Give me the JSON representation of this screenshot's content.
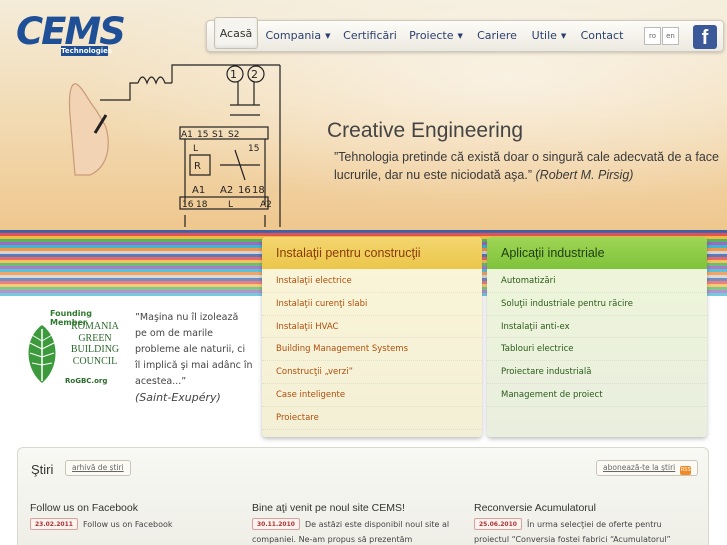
{
  "brand": {
    "name": "CEMS",
    "sub": "Technologies"
  },
  "nav": {
    "items": [
      {
        "label": "Acasă"
      },
      {
        "label": "Compania",
        "caret": "▼"
      },
      {
        "label": "Certificări"
      },
      {
        "label": "Proiecte",
        "caret": "▼"
      },
      {
        "label": "Cariere"
      },
      {
        "label": "Utile",
        "caret": "▼"
      },
      {
        "label": "Contact"
      }
    ],
    "lang": [
      "ro",
      "en"
    ],
    "fb": "f"
  },
  "hero": {
    "sketch_labels": [
      "1",
      "2",
      "A1",
      "15",
      "S1",
      "S2",
      "L",
      "15",
      "R",
      "A1",
      "A2",
      "16",
      "18",
      "16",
      "18",
      "L",
      "A2"
    ],
    "title": "Creative Engineering",
    "quote": "”Tehnologia pretinde că există doar o singură cale adecvată de a face lucrurile, dar nu este niciodată aşa.”",
    "author": "(Robert M. Pirsig)"
  },
  "panels": {
    "constructii": {
      "title": "Instalaţii pentru construcţii",
      "items": [
        "Instalaţii electrice",
        "Instalaţii curenţi slabi",
        "Instalaţii HVAC",
        "Building Management Systems",
        "Construcţii „verzi”",
        "Case inteligente",
        "Proiectare"
      ]
    },
    "industriale": {
      "title": "Aplicaţii industriale",
      "items": [
        "Automatizări",
        "Soluţii industriale pentru răcire",
        "Instalaţii anti-ex",
        "Tablouri electrice",
        "Proiectare industrială",
        "Management de proiect"
      ]
    }
  },
  "gbc": {
    "founding": "Founding Member",
    "org": [
      "ROMANIA",
      "GREEN",
      "BUILDING",
      "COUNCIL"
    ],
    "url": "RoGBC.org"
  },
  "saint": {
    "quote": "”Maşina nu îl izolează pe om de marile probleme ale naturii, ci îl implică şi mai adânc în acestea...”",
    "author": "(Saint-Exupéry)"
  },
  "news": {
    "title": "Ştiri",
    "archive": "arhivă de ştiri",
    "subscribe": "abonează-te la ştiri",
    "rss": "RSS",
    "items": [
      {
        "title": "Follow us on Facebook",
        "date": "23.02.2011",
        "text": "Follow us on Facebook"
      },
      {
        "title": "Bine aţi venit pe noul site CEMS!",
        "date": "30.11.2010",
        "text": "De astăzi este disponibil noul site al companiei. Ne-am propus să prezentăm"
      },
      {
        "title": "Reconversie Acumulatorul",
        "date": "25.06.2010",
        "text": "În urma selecţiei de oferte pentru proiectul “Conversia fostei fabrici “Acumulatorul”"
      }
    ]
  }
}
